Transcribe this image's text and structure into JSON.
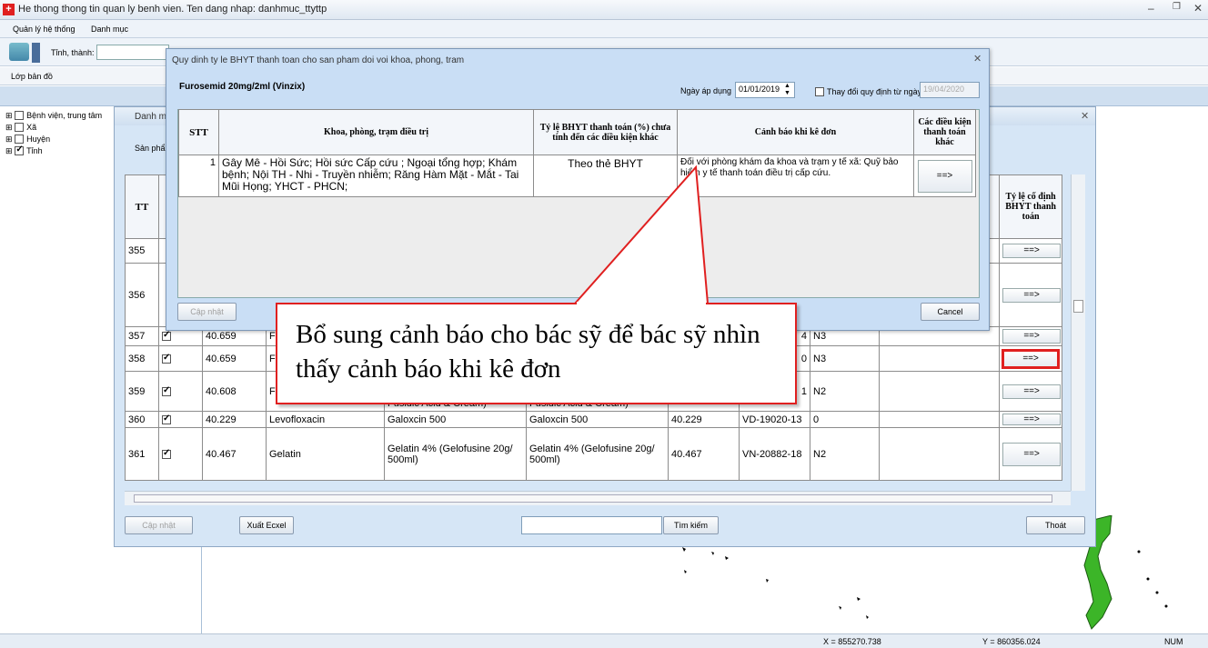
{
  "app": {
    "title": "He thong thong tin quan ly benh vien. Ten dang nhap: danhmuc_ttyttp",
    "menu": [
      "Quản lý hệ thống",
      "Danh mục"
    ],
    "province_label": "Tỉnh, thành:",
    "layer_label": "Lớp bản đồ"
  },
  "tree": [
    {
      "label": "Bệnh viện, trung tâm",
      "checked": false
    },
    {
      "label": "Xã",
      "checked": false
    },
    {
      "label": "Huyện",
      "checked": false
    },
    {
      "label": "Tỉnh",
      "checked": true
    }
  ],
  "status": {
    "x": "X = 855270.738",
    "y": "Y = 860356.024",
    "num": "NUM"
  },
  "list_window": {
    "title": "Danh m",
    "product_label": "Sản phẩm",
    "col_tt": "TT",
    "col_fixed": "Tỷ lệ cố định BHYT thanh toán",
    "rows": [
      {
        "tt": "355",
        "code": "",
        "name": "",
        "trade": "",
        "trade2": "",
        "code2": "",
        "reg": "",
        "grp": "",
        "btn": "==>"
      },
      {
        "tt": "356",
        "code": "",
        "name": "",
        "trade": "",
        "trade2": "",
        "code2": "",
        "reg": "",
        "grp": "",
        "btn": "==>"
      },
      {
        "tt": "357",
        "code": "40.659",
        "name": "F",
        "trade": "",
        "trade2": "",
        "code2": "",
        "reg": "4",
        "grp": "N3",
        "btn": "==>"
      },
      {
        "tt": "358",
        "code": "40.659",
        "name": "F",
        "trade": "",
        "trade2": "",
        "code2": "",
        "reg": "0",
        "grp": "N3",
        "btn": "==>"
      },
      {
        "tt": "359",
        "code": "40.608",
        "name": "F b",
        "trade": "Fusidic Acid & Cream)",
        "trade2": "Fusidic Acid & Cream)",
        "code2": "",
        "reg": "1",
        "grp": "N2",
        "btn": "==>"
      },
      {
        "tt": "360",
        "code": "40.229",
        "name": "Levofloxacin",
        "trade": "Galoxcin 500",
        "trade2": "Galoxcin 500",
        "code2": "40.229",
        "reg": "VD-19020-13",
        "grp": "0",
        "btn": "==>"
      },
      {
        "tt": "361",
        "code": "40.467",
        "name": "Gelatin",
        "trade": "Gelatin 4% (Gelofusine 20g/ 500ml)",
        "trade2": "Gelatin 4% (Gelofusine 20g/ 500ml)",
        "code2": "40.467",
        "reg": "VN-20882-18",
        "grp": "N2",
        "btn": "==>"
      }
    ],
    "update_btn": "Cập nhật",
    "export_btn": "Xuất Ecxel",
    "search_btn": "Tìm kiếm",
    "exit_btn": "Thoát",
    "search_value": ""
  },
  "dialog": {
    "title": "Quy dinh ty le BHYT thanh toan  cho san pham doi voi  khoa, phong, tram",
    "product": "Furosemid 20mg/2ml (Vinzix)",
    "date_label": "Ngày áp dụng",
    "date_value": "01/01/2019",
    "change_label": "Thay đổi quy định từ ngày",
    "change_date": "19/04/2020",
    "headers": {
      "stt": "STT",
      "dept": "Khoa, phòng, trạm điều trị",
      "rate": "Tỷ lệ BHYT thanh toán (%) chưa tính đến các điều kiện khác",
      "warn": "Cảnh báo khi kê đơn",
      "other": "Các điều kiện thanh toán khác"
    },
    "rows": [
      {
        "stt": "1",
        "dept": "Gây Mê - Hồi Sức; Hồi sức Cấp cứu ; Ngoại tổng hợp; Khám bệnh; Nội TH - Nhi - Truyền nhiễm; Răng Hàm Mặt - Mắt - Tai Mũi Họng; YHCT - PHCN;",
        "rate": "Theo thẻ BHYT",
        "warn": "Đối với phòng khám đa khoa và trạm y tế xã: Quỹ bảo hiểm y tế thanh toán điều trị cấp cứu.",
        "other": "==>"
      }
    ],
    "update_btn": "Cập nhật",
    "cancel_btn": "Cancel"
  },
  "callout": {
    "text": "Bổ sung cảnh báo cho bác sỹ để bác sỹ nhìn thấy cảnh báo khi kê đơn"
  },
  "colors": {
    "accent": "#e02020",
    "window": "#d6e6f6",
    "dialog": "#c9def5",
    "map_green": "#3cb528"
  }
}
